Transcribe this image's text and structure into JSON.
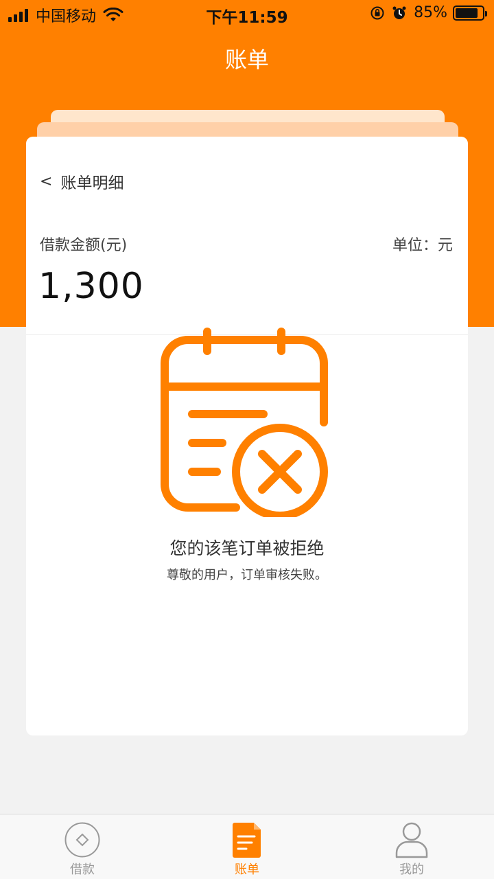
{
  "status_bar": {
    "carrier": "中国移动",
    "time": "下午11:59",
    "battery": "85%"
  },
  "nav": {
    "title": "账单"
  },
  "card": {
    "back_label": "账单明细",
    "amount_label": "借款金额(元)",
    "unit_label": "单位：元",
    "amount_value": "1,300",
    "reject_title": "您的该笔订单被拒绝",
    "reject_subtitle": "尊敬的用户，订单审核失败。"
  },
  "tabs": [
    {
      "label": "借款",
      "icon": "loan-icon",
      "active": false
    },
    {
      "label": "账单",
      "icon": "bill-icon",
      "active": true
    },
    {
      "label": "我的",
      "icon": "user-icon",
      "active": false
    }
  ],
  "colors": {
    "accent": "#ff8000",
    "tab_inactive": "#999999"
  }
}
